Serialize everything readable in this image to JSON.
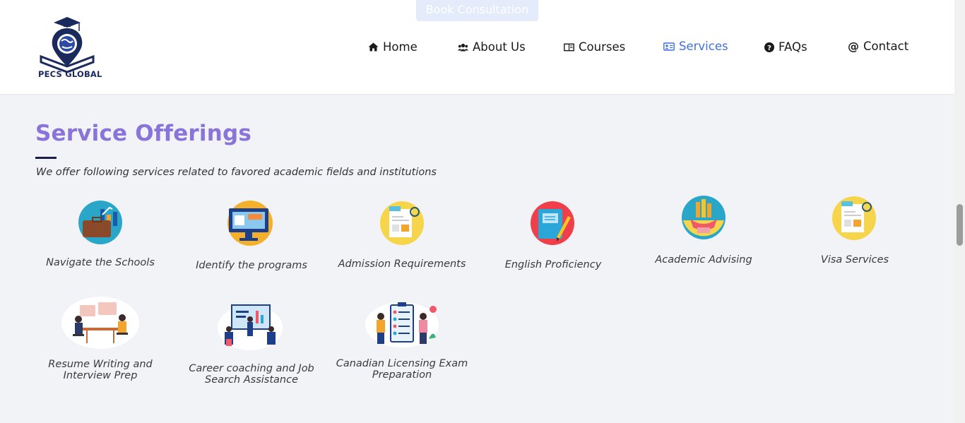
{
  "header": {
    "book_consultation": "Book Consultation",
    "logo_text": "PECS GLOBAL",
    "nav": [
      {
        "label": "Home",
        "icon": "home-icon"
      },
      {
        "label": "About Us",
        "icon": "users-icon"
      },
      {
        "label": "Courses",
        "icon": "book-icon"
      },
      {
        "label": "Services",
        "icon": "id-card-icon",
        "active": true
      },
      {
        "label": "FAQs",
        "icon": "question-circle-icon"
      },
      {
        "label": "Contact",
        "icon": "at-icon"
      }
    ]
  },
  "main": {
    "title": "Service Offerings",
    "subtitle": "We offer following services related to favored academic fields and institutions",
    "services": [
      {
        "label": "Navigate the Schools",
        "icon": "briefcase-chart-icon"
      },
      {
        "label": "Identify the programs",
        "icon": "computer-monitor-icon"
      },
      {
        "label": "Admission Requirements",
        "icon": "newspaper-icon"
      },
      {
        "label": "English Proficiency",
        "icon": "notebook-pen-icon"
      },
      {
        "label": "Academic Advising",
        "icon": "trophy-icon"
      },
      {
        "label": "Visa Services",
        "icon": "newspaper-icon"
      },
      {
        "label": "Resume Writing and Interview Prep",
        "icon": "interview-illustration-icon"
      },
      {
        "label": "Career coaching and Job Search Assistance",
        "icon": "presentation-illustration-icon"
      },
      {
        "label": "Canadian Licensing Exam Preparation",
        "icon": "checklist-illustration-icon"
      }
    ]
  },
  "colors": {
    "accent": "#8a74d9",
    "nav_active": "#3f6fe0",
    "navy": "#1a1f4a",
    "background": "#f1f3f7"
  }
}
